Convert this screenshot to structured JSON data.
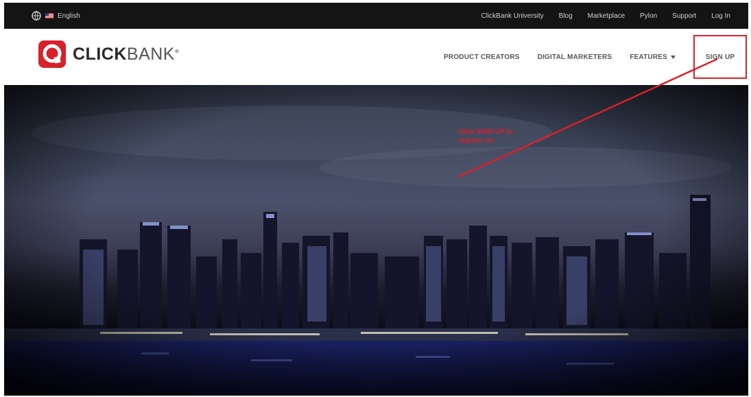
{
  "utility_bar": {
    "language": "English",
    "links": [
      "ClickBank University",
      "Blog",
      "Marketplace",
      "Pylon",
      "Support",
      "Log In"
    ]
  },
  "header": {
    "brand_bold": "CLICK",
    "brand_light": "BANK",
    "brand_mark": "®",
    "nav": {
      "product_creators": "PRODUCT CREATORS",
      "digital_marketers": "DIGITAL MARKETERS",
      "features": "FEATURES",
      "sign_up": "SIGN UP"
    }
  },
  "annotation": {
    "line1": "Click SIGN UP to",
    "line2": "register on"
  },
  "colors": {
    "brand_red": "#d8202a",
    "utility_bar": "#141414",
    "annotation_red": "#d8202a"
  },
  "icons": [
    "globe-icon",
    "us-flag-icon",
    "clickbank-logo-icon",
    "chevron-down-icon"
  ]
}
